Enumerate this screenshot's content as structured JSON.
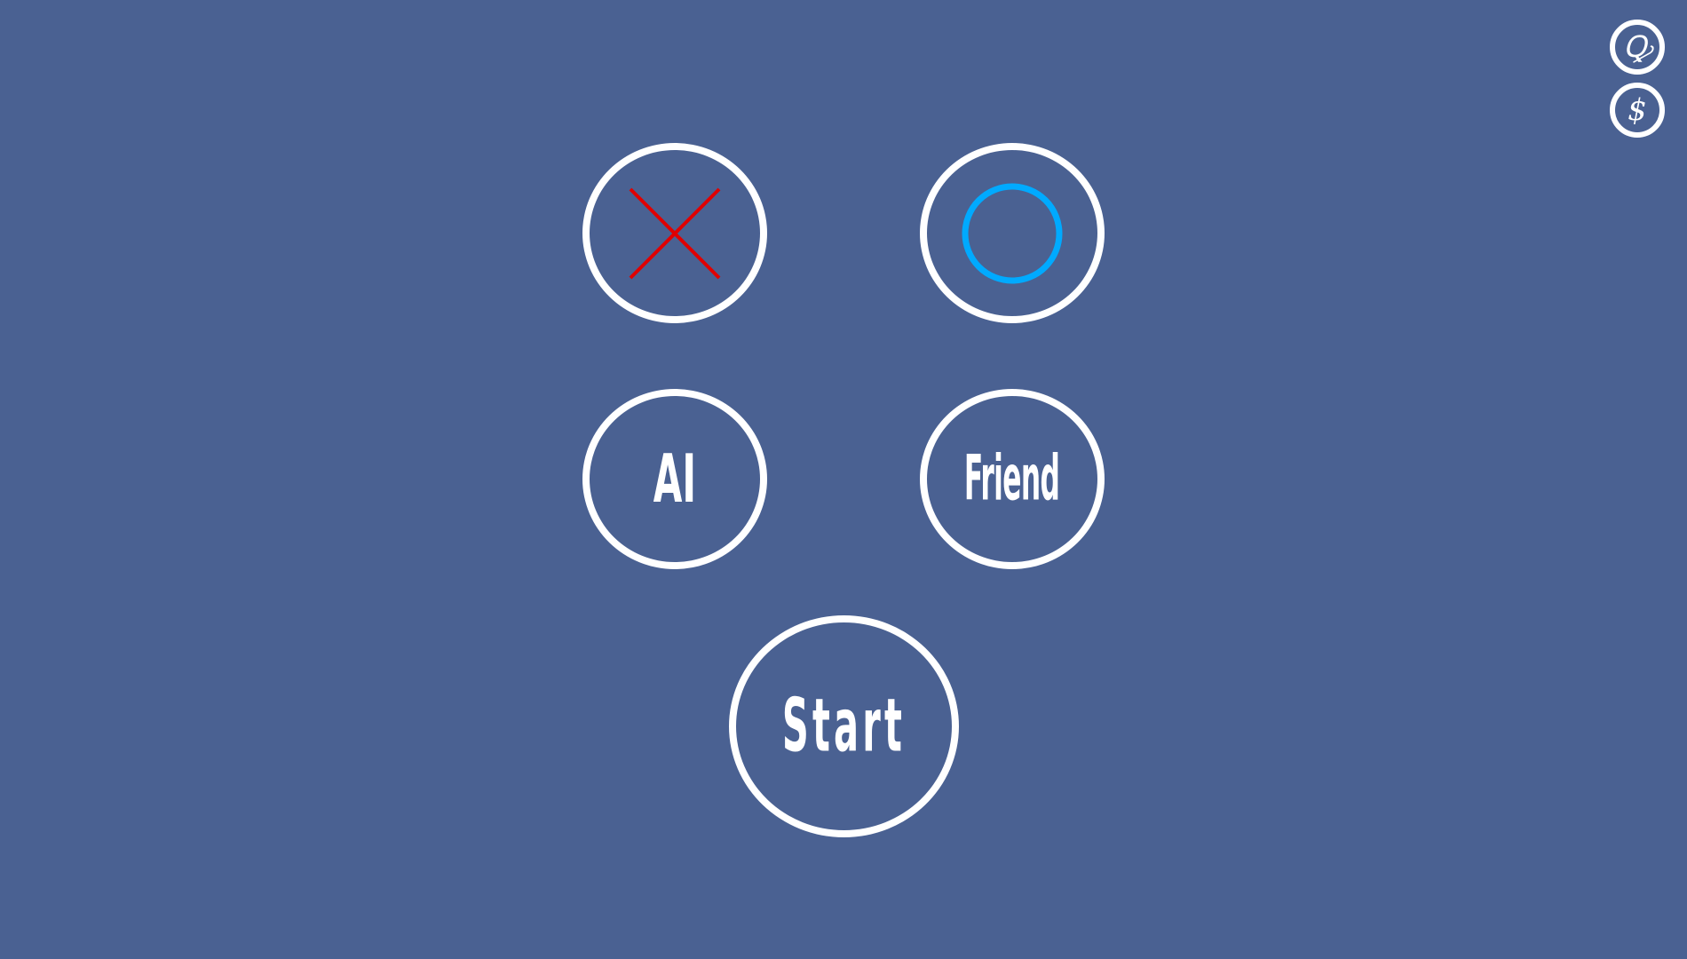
{
  "colors": {
    "background": "#4a6192",
    "ring": "#ffffff",
    "x_mark": "#e00000",
    "o_mark": "#00aaff"
  },
  "top_right": {
    "button1_icon": "swirl-emblem-icon",
    "button1_glyph": "Ꝙ",
    "button2_icon": "currency-dollar-icon",
    "button2_glyph": "$"
  },
  "symbols": {
    "x_icon": "cross-x-icon",
    "o_icon": "circle-o-icon"
  },
  "opponent": {
    "ai_label": "AI",
    "friend_label": "Friend"
  },
  "start_label": "Start"
}
